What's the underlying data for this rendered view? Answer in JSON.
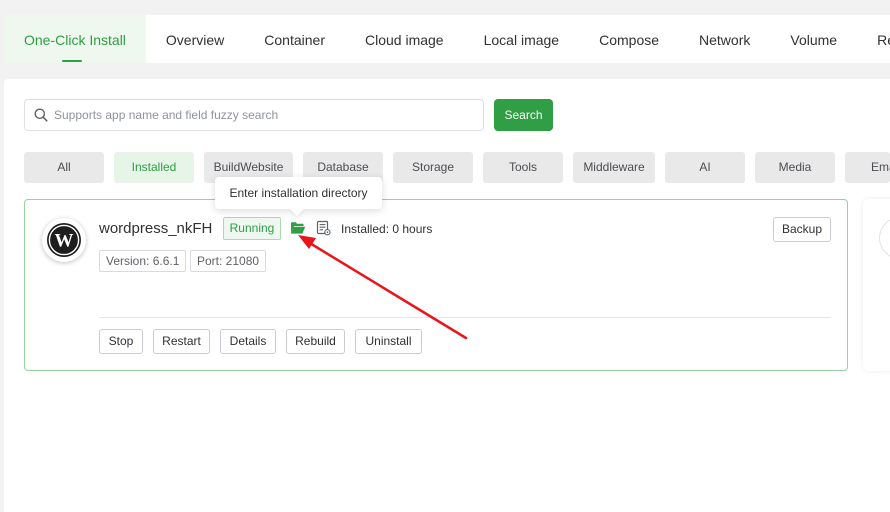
{
  "nav": {
    "tabs": [
      {
        "label": "One-Click Install",
        "active": true
      },
      {
        "label": "Overview"
      },
      {
        "label": "Container"
      },
      {
        "label": "Cloud image"
      },
      {
        "label": "Local image"
      },
      {
        "label": "Compose"
      },
      {
        "label": "Network"
      },
      {
        "label": "Volume"
      },
      {
        "label": "Rep"
      }
    ]
  },
  "search": {
    "placeholder": "Supports app name and field fuzzy search",
    "button_label": "Search"
  },
  "categories": [
    "All",
    "Installed",
    "BuildWebsite",
    "Database",
    "Storage",
    "Tools",
    "Middleware",
    "AI",
    "Media",
    "Ema"
  ],
  "active_category": "Installed",
  "tooltip": "Enter installation directory",
  "app": {
    "name": "wordpress_nkFH",
    "status": "Running",
    "installed": "Installed: 0 hours",
    "version": "Version: 6.6.1",
    "port": "Port: 21080",
    "backup_label": "Backup",
    "icons": {
      "logo": "wordpress-icon",
      "folder": "folder-open-icon",
      "log": "log-icon"
    },
    "actions": [
      "Stop",
      "Restart",
      "Details",
      "Rebuild",
      "Uninstall"
    ]
  },
  "colors": {
    "accent": "#2f9e44",
    "annotation_arrow": "#e8161b"
  }
}
